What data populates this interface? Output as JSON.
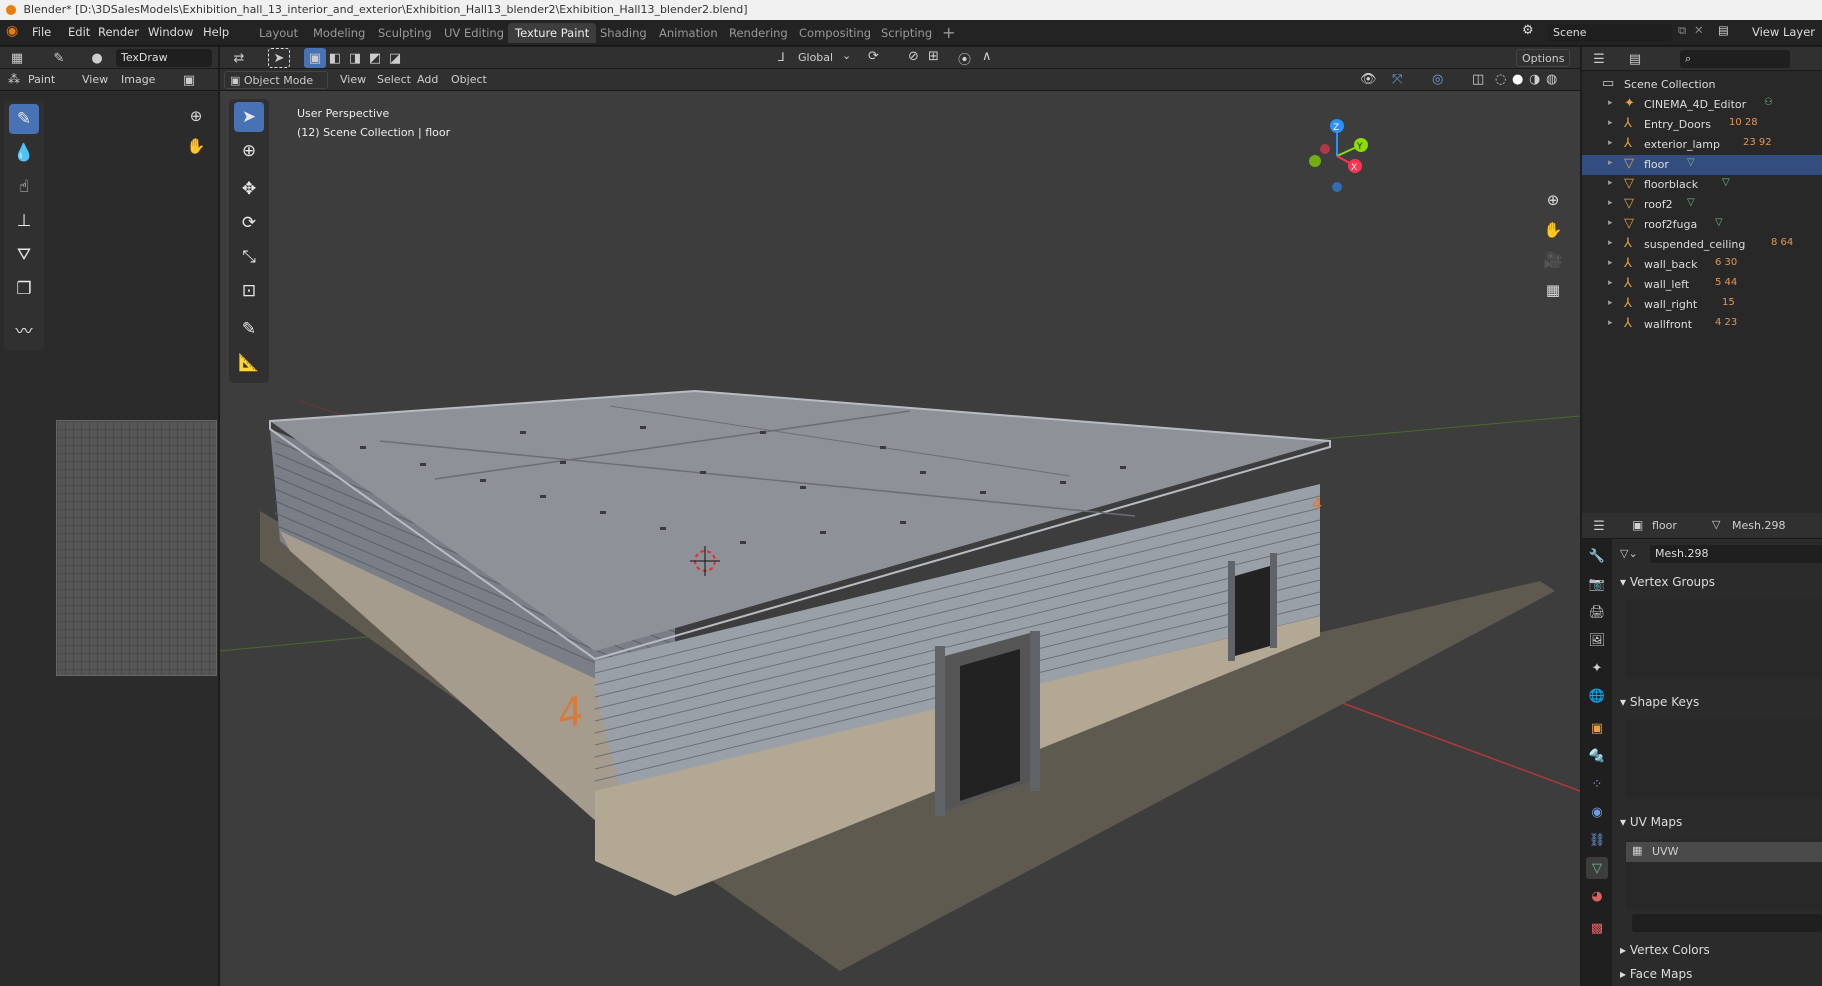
{
  "window": {
    "title": "Blender* [D:\\3DSalesModels\\Exhibition_hall_13_interior_and_exterior\\Exhibition_Hall13_blender2\\Exhibition_Hall13_blender2.blend]"
  },
  "menu": {
    "items": [
      "File",
      "Edit",
      "Render",
      "Window",
      "Help"
    ]
  },
  "workspaces": {
    "tabs": [
      "Layout",
      "Modeling",
      "Sculpting",
      "UV Editing",
      "Texture Paint",
      "Shading",
      "Animation",
      "Rendering",
      "Compositing",
      "Scripting"
    ],
    "active": "Texture Paint"
  },
  "scene": {
    "label": "Scene",
    "view_layer": "View Layer"
  },
  "image_editor": {
    "brush_name": "TexDraw",
    "mode": "Paint",
    "menus": [
      "View",
      "Image"
    ]
  },
  "viewport_header": {
    "mode": "Object Mode",
    "menus": [
      "View",
      "Select",
      "Add",
      "Object"
    ],
    "orientation": "Global",
    "options": "Options"
  },
  "viewport": {
    "perspective": "User Perspective",
    "collection_info": "(12) Scene Collection | floor",
    "wall_number": "4",
    "gizmo_axes": {
      "z": "Z",
      "y": "Y",
      "x": "X"
    }
  },
  "outliner": {
    "root": "Scene Collection",
    "items": [
      {
        "name": "CINEMA_4D_Editor",
        "icon": "camera-icon",
        "extra": ""
      },
      {
        "name": "Entry_Doors",
        "icon": "empty-icon",
        "extra": "10 28"
      },
      {
        "name": "exterior_lamp",
        "icon": "empty-icon",
        "extra": "23 92"
      },
      {
        "name": "floor",
        "icon": "mesh-icon",
        "extra": ""
      },
      {
        "name": "floorblack",
        "icon": "mesh-icon",
        "extra": ""
      },
      {
        "name": "roof2",
        "icon": "mesh-icon",
        "extra": ""
      },
      {
        "name": "roof2fuga",
        "icon": "mesh-icon",
        "extra": ""
      },
      {
        "name": "suspended_ceiling",
        "icon": "empty-icon",
        "extra": "8 64"
      },
      {
        "name": "wall_back",
        "icon": "empty-icon",
        "extra": "6 30"
      },
      {
        "name": "wall_left",
        "icon": "empty-icon",
        "extra": "5 44"
      },
      {
        "name": "wall_right",
        "icon": "empty-icon",
        "extra": "15"
      },
      {
        "name": "wallfront",
        "icon": "empty-icon",
        "extra": "4 23"
      }
    ]
  },
  "properties": {
    "object": "floor",
    "mesh": "Mesh.298",
    "mesh_field": "Mesh.298",
    "panels": {
      "vertex_groups": "Vertex Groups",
      "shape_keys": "Shape Keys",
      "uv_maps": "UV Maps",
      "uv_item": "UVW",
      "vertex_colors": "Vertex Colors",
      "face_maps": "Face Maps"
    }
  },
  "colors": {
    "accent": "#4772b3",
    "orange": "#e87d0d",
    "mesh_green": "#6cc08b",
    "axis_red": "#ff3352",
    "axis_green": "#8bdc00",
    "axis_blue": "#2890ff"
  }
}
